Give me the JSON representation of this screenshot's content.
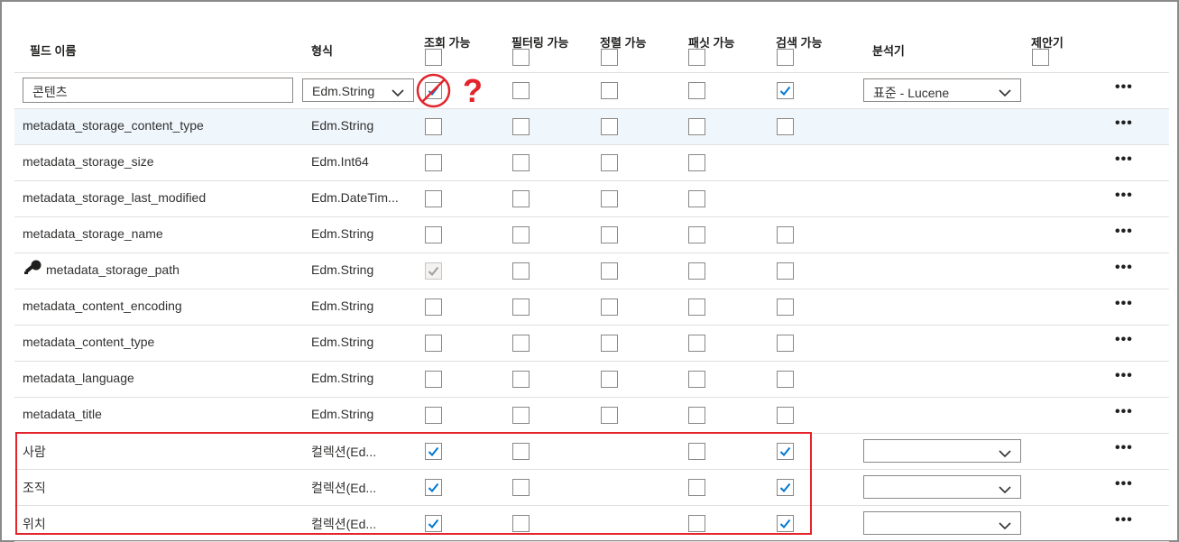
{
  "headers": {
    "field_name": "필드 이름",
    "type": "형식",
    "retrievable": "조회 가능",
    "filterable": "필터링 가능",
    "sortable": "정렬 가능",
    "facetable": "패싯 가능",
    "searchable": "검색 가능",
    "analyzer": "분석기",
    "suggester": "제안기"
  },
  "annotation": {
    "question_mark": "?"
  },
  "more_label": "•••",
  "colors": {
    "accent": "#0078d4",
    "annotation_red": "#e3242b",
    "selected_row": "#eff6fc"
  },
  "rows": [
    {
      "name": "콘텐츠",
      "type": "Edm.String",
      "editable": true,
      "type_dropdown": true,
      "retrievable": true,
      "filterable": false,
      "sortable": false,
      "facetable": false,
      "searchable": true,
      "analyzer": "표준 - Lucene"
    },
    {
      "name": "metadata_storage_content_type",
      "type": "Edm.String",
      "selected": true,
      "retrievable": false,
      "filterable": false,
      "sortable": false,
      "facetable": false,
      "searchable": false
    },
    {
      "name": "metadata_storage_size",
      "type": "Edm.Int64",
      "retrievable": false,
      "filterable": false,
      "sortable": false,
      "facetable": false,
      "searchable": null
    },
    {
      "name": "metadata_storage_last_modified",
      "type": "Edm.DateTim...",
      "retrievable": false,
      "filterable": false,
      "sortable": false,
      "facetable": false,
      "searchable": null
    },
    {
      "name": "metadata_storage_name",
      "type": "Edm.String",
      "retrievable": false,
      "filterable": false,
      "sortable": false,
      "facetable": false,
      "searchable": false
    },
    {
      "name": "metadata_storage_path",
      "type": "Edm.String",
      "key": true,
      "retrievable": "disabled-checked",
      "filterable": false,
      "sortable": false,
      "facetable": false,
      "searchable": false
    },
    {
      "name": "metadata_content_encoding",
      "type": "Edm.String",
      "retrievable": false,
      "filterable": false,
      "sortable": false,
      "facetable": false,
      "searchable": false
    },
    {
      "name": "metadata_content_type",
      "type": "Edm.String",
      "retrievable": false,
      "filterable": false,
      "sortable": false,
      "facetable": false,
      "searchable": false
    },
    {
      "name": "metadata_language",
      "type": "Edm.String",
      "retrievable": false,
      "filterable": false,
      "sortable": false,
      "facetable": false,
      "searchable": false
    },
    {
      "name": "metadata_title",
      "type": "Edm.String",
      "retrievable": false,
      "filterable": false,
      "sortable": false,
      "facetable": false,
      "searchable": false
    },
    {
      "name": "사람",
      "type": "컬렉션(Ed...",
      "retrievable": true,
      "filterable": false,
      "sortable": null,
      "facetable": false,
      "searchable": true,
      "analyzer": ""
    },
    {
      "name": "조직",
      "type": "컬렉션(Ed...",
      "retrievable": true,
      "filterable": false,
      "sortable": null,
      "facetable": false,
      "searchable": true,
      "analyzer": ""
    },
    {
      "name": "위치",
      "type": "컬렉션(Ed...",
      "retrievable": true,
      "filterable": false,
      "sortable": null,
      "facetable": false,
      "searchable": true,
      "analyzer": ""
    }
  ]
}
